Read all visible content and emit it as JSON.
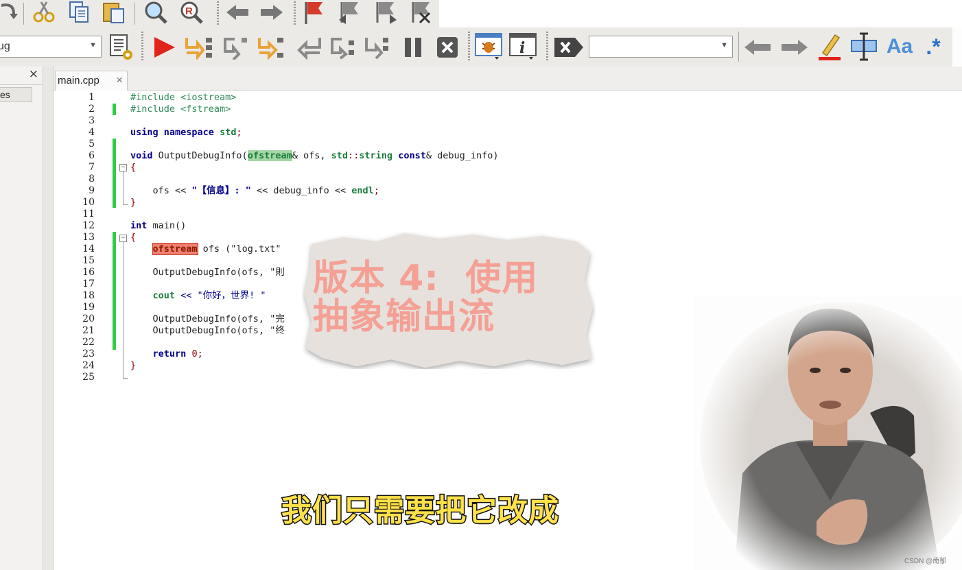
{
  "toolbar": {
    "config_combo_value": "ug",
    "find_combo_value": "",
    "icons": [
      "step-over-icon",
      "cut-icon",
      "copy-icon",
      "paste-icon",
      "find-icon",
      "find-replace-icon",
      "undo-icon",
      "redo-icon",
      "bookmark-flag-icon",
      "prev-bookmark-icon",
      "next-bookmark-icon",
      "clear-bookmarks-icon",
      "build-options-icon",
      "run-icon",
      "step-into-icon",
      "step-out-icon",
      "next-line-icon",
      "step-back-icon",
      "run-to-cursor-icon",
      "next-instruction-icon",
      "pause-icon",
      "stop-debug-icon",
      "debug-window-icon",
      "info-window-icon",
      "clear-icon",
      "nav-back-icon",
      "nav-forward-icon",
      "highlight-icon",
      "selection-icon",
      "match-case-icon",
      "regex-icon"
    ],
    "match_case_label": "Aa",
    "regex_label": ".*"
  },
  "left_panel": {
    "close_label": "×",
    "tab_label": "es"
  },
  "editor": {
    "tab_label": "main.cpp",
    "tab_close": "×",
    "line_numbers": [
      "1",
      "2",
      "3",
      "4",
      "5",
      "6",
      "7",
      "8",
      "9",
      "10",
      "11",
      "12",
      "13",
      "14",
      "15",
      "16",
      "17",
      "18",
      "19",
      "20",
      "21",
      "22",
      "23",
      "24",
      "25"
    ],
    "lines": {
      "l1": "#include <iostream>",
      "l2": "#include <fstream>",
      "l4_kw1": "using",
      "l4_kw2": "namespace",
      "l4_std": "std",
      "l4_end": ";",
      "l6_void": "void",
      "l6_fn": " OutputDebugInfo(",
      "l6_type": "ofstream",
      "l6_rest1": "& ofs, ",
      "l6_std": "std",
      "l6_sep": "::",
      "l6_string": "string",
      "l6_sp": " ",
      "l6_const": "const",
      "l6_rest2": "& debug_info)",
      "l7": "{",
      "l9_a": "    ofs << ",
      "l9_str": "\"【信息】: \"",
      "l9_b": " << debug_info << ",
      "l9_endl": "endl",
      "l9_c": ";",
      "l10": "}",
      "l12_int": "int",
      "l12_rest": " main()",
      "l13": "{",
      "l14_type": "ofstream",
      "l14_rest": " ofs (\"log.txt\"",
      "l16": "    OutputDebugInfo(ofs, \"則",
      "l18_cout": "cout",
      "l18_rest": " << \"你好，世界! \"",
      "l20": "    OutputDebugInfo(ofs, \"完",
      "l21": "    OutputDebugInfo(ofs, \"终",
      "l23_ret": "return",
      "l23_num": "0",
      "l23_end": ";",
      "l24": "}"
    }
  },
  "overlay": {
    "title_line1": "版本 4:  使用",
    "title_line2": "抽象输出流",
    "subtitle": "我们只需要把它改成",
    "watermark": "CSDN @南郁"
  },
  "colors": {
    "keyword": "#00008b",
    "include": "#2e8b57",
    "change_marker": "#33cc44",
    "title_overlay": "#f4a095",
    "subtitle": "#ffe14a"
  }
}
